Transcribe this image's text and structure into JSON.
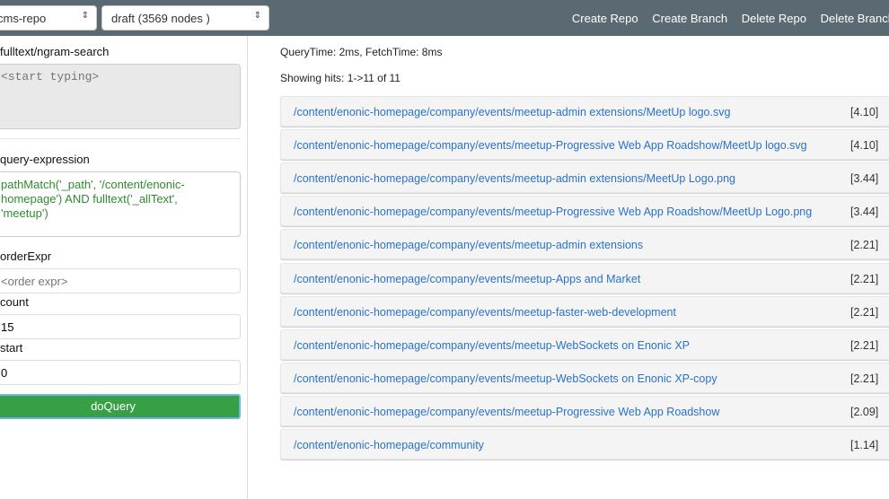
{
  "topbar": {
    "repo_select": "cms-repo",
    "branch_select": "draft (3569 nodes )",
    "nav": [
      "Create Repo",
      "Create Branch",
      "Delete Repo",
      "Delete Branch"
    ]
  },
  "left": {
    "fulltext_label": "fulltext/ngram-search",
    "fulltext_placeholder": "<start typing>",
    "query_label": "query-expression",
    "query_value": "pathMatch('_path', '/content/enonic-homepage') AND fulltext('_allText', 'meetup')",
    "order_label": "orderExpr",
    "order_placeholder": "<order expr>",
    "count_label": "count",
    "count_value": "15",
    "start_label": "start",
    "start_value": "0",
    "button": "doQuery"
  },
  "results": {
    "timing": "QueryTime: 2ms, FetchTime: 8ms",
    "showing": "Showing hits: 1->11 of 11",
    "hits": [
      {
        "path": "/content/enonic-homepage/company/events/meetup-admin extensions/MeetUp logo.svg",
        "score": "[4.10]"
      },
      {
        "path": "/content/enonic-homepage/company/events/meetup-Progressive Web App Roadshow/MeetUp logo.svg",
        "score": "[4.10]"
      },
      {
        "path": "/content/enonic-homepage/company/events/meetup-admin extensions/MeetUp Logo.png",
        "score": "[3.44]"
      },
      {
        "path": "/content/enonic-homepage/company/events/meetup-Progressive Web App Roadshow/MeetUp Logo.png",
        "score": "[3.44]"
      },
      {
        "path": "/content/enonic-homepage/company/events/meetup-admin extensions",
        "score": "[2.21]"
      },
      {
        "path": "/content/enonic-homepage/company/events/meetup-Apps and Market",
        "score": "[2.21]"
      },
      {
        "path": "/content/enonic-homepage/company/events/meetup-faster-web-development",
        "score": "[2.21]"
      },
      {
        "path": "/content/enonic-homepage/company/events/meetup-WebSockets on Enonic XP",
        "score": "[2.21]"
      },
      {
        "path": "/content/enonic-homepage/company/events/meetup-WebSockets on Enonic XP-copy",
        "score": "[2.21]"
      },
      {
        "path": "/content/enonic-homepage/company/events/meetup-Progressive Web App Roadshow",
        "score": "[2.09]"
      },
      {
        "path": "/content/enonic-homepage/community",
        "score": "[1.14]"
      }
    ]
  }
}
